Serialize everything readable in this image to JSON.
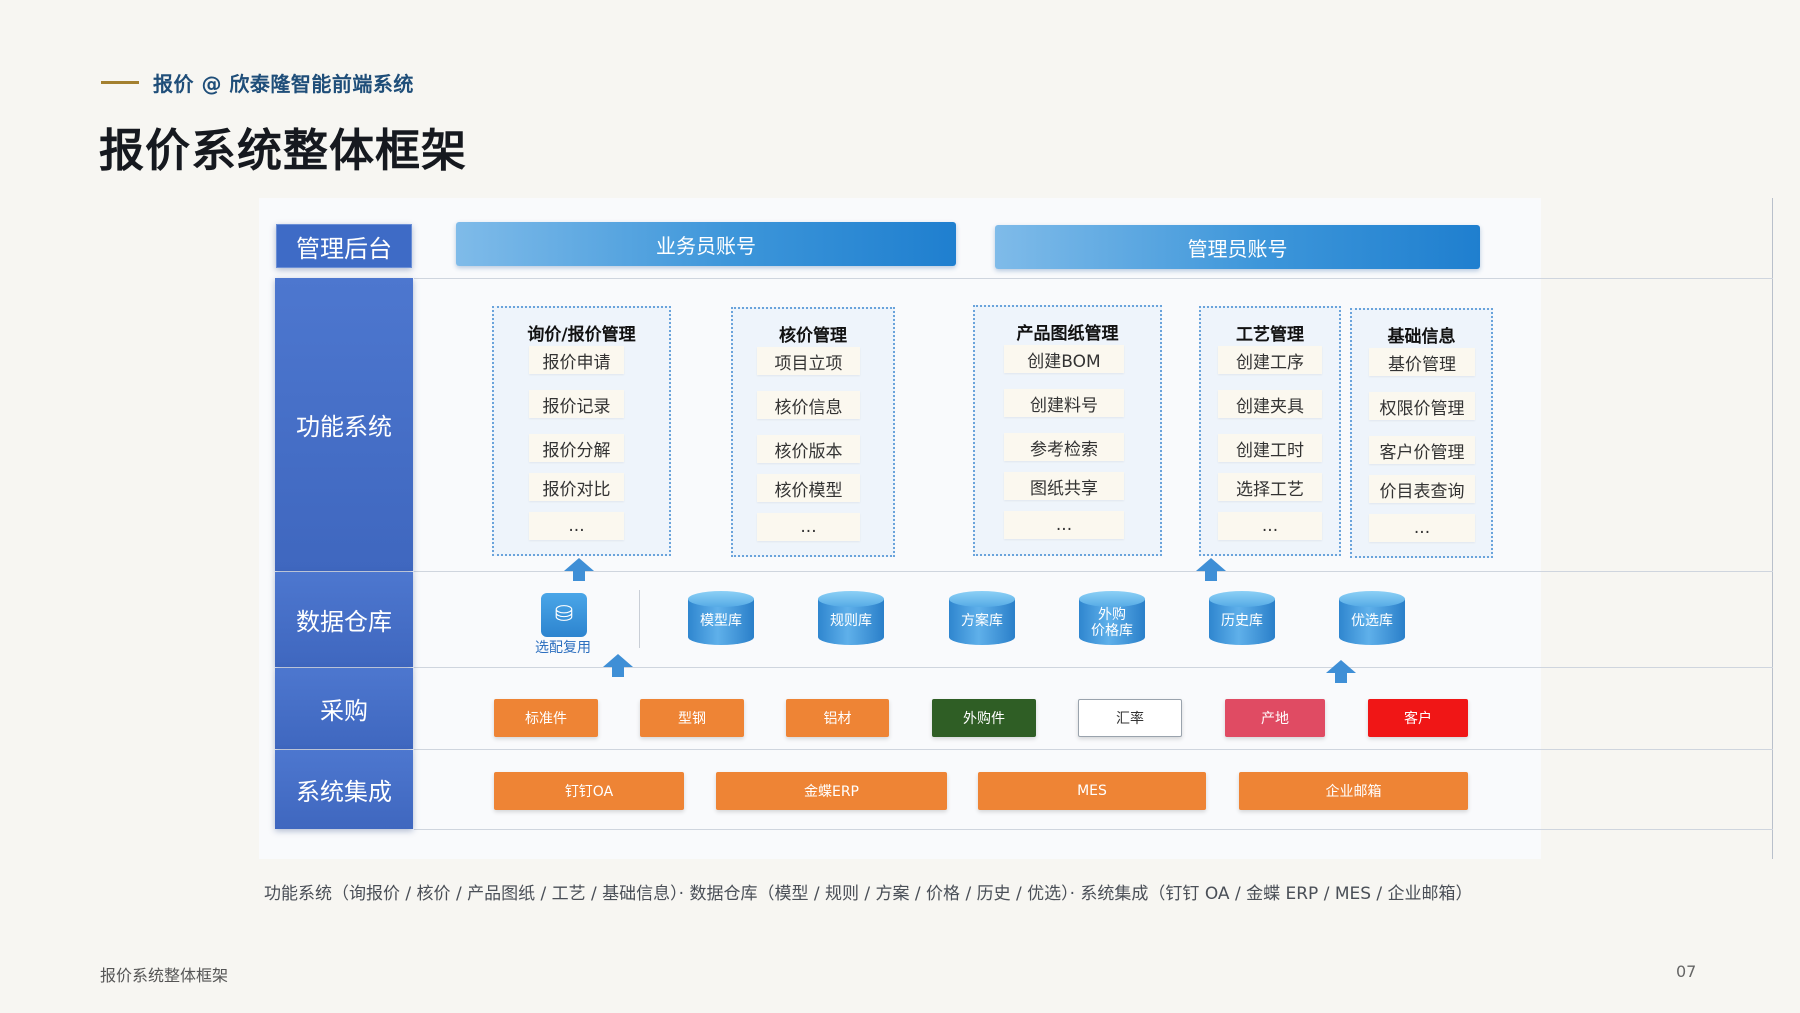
{
  "header": {
    "eyebrow": "报价 @ 欣泰隆智能前端系统",
    "title": "报价系统整体框架"
  },
  "diagram": {
    "layers": {
      "admin": "管理后台",
      "functions": "功能系统",
      "warehouse": "数据仓库",
      "procurement": "采购",
      "integration": "系统集成"
    },
    "accounts": [
      "业务员账号",
      "管理员账号"
    ],
    "groups": [
      {
        "title": "询价/报价管理",
        "items": [
          "报价申请",
          "报价记录",
          "报价分解",
          "报价对比",
          "..."
        ]
      },
      {
        "title": "核价管理",
        "items": [
          "项目立项",
          "核价信息",
          "核价版本",
          "核价模型",
          "..."
        ]
      },
      {
        "title": "产品图纸管理",
        "items": [
          "创建BOM",
          "创建料号",
          "参考检索",
          "图纸共享",
          "..."
        ]
      },
      {
        "title": "工艺管理",
        "items": [
          "创建工序",
          "创建夹具",
          "创建工时",
          "选择工艺",
          "..."
        ]
      },
      {
        "title": "基础信息",
        "items": [
          "基价管理",
          "权限价管理",
          "客户价管理",
          "价目表查询",
          "..."
        ]
      }
    ],
    "reuse_label": "选配复用",
    "databases": [
      "模型库",
      "规则库",
      "方案库",
      "外购\n价格库",
      "历史库",
      "优选库"
    ],
    "procurement": [
      {
        "label": "标准件",
        "color": "#ee8435"
      },
      {
        "label": "型钢",
        "color": "#ee8435"
      },
      {
        "label": "铝材",
        "color": "#ee8435"
      },
      {
        "label": "外购件",
        "color": "#2f5e25"
      },
      {
        "label": "汇率",
        "color": "#ffffff"
      },
      {
        "label": "产地",
        "color": "#e04b63"
      },
      {
        "label": "客户",
        "color": "#f01616"
      }
    ],
    "integrations": [
      "钉钉OA",
      "金蝶ERP",
      "MES",
      "企业邮箱"
    ]
  },
  "caption": "功能系统（询报价 / 核价 / 产品图纸 / 工艺 / 基础信息）· 数据仓库（模型 / 规则 / 方案 / 价格 / 历史 / 优选）· 系统集成（钉钉 OA / 金蝶 ERP / MES / 企业邮箱）",
  "footer": {
    "left": "报价系统整体框架",
    "page": "07"
  }
}
